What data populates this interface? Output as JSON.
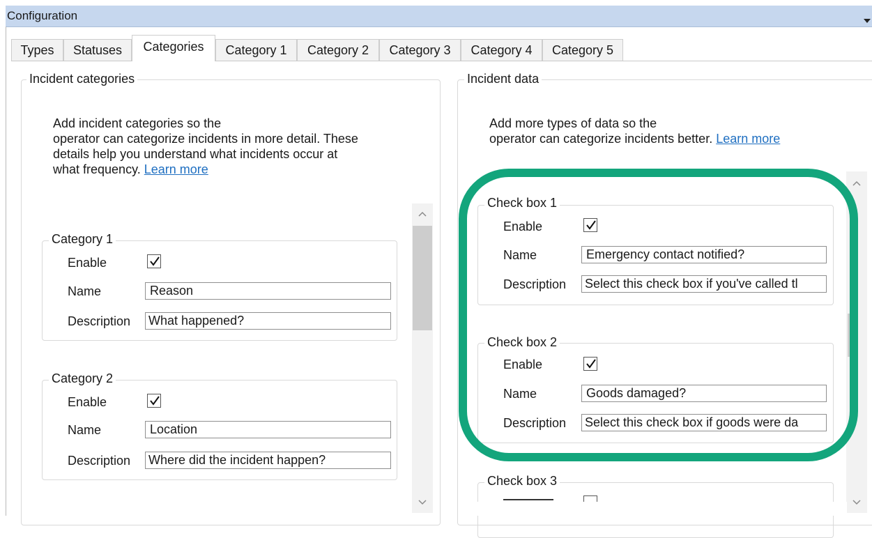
{
  "window": {
    "title": "Configuration"
  },
  "tabs": [
    {
      "label": "Types",
      "active": false
    },
    {
      "label": "Statuses",
      "active": false
    },
    {
      "label": "Categories",
      "active": true
    },
    {
      "label": "Category 1",
      "active": false
    },
    {
      "label": "Category 2",
      "active": false
    },
    {
      "label": "Category 3",
      "active": false
    },
    {
      "label": "Category 4",
      "active": false
    },
    {
      "label": "Category 5",
      "active": false
    }
  ],
  "left_panel": {
    "legend": "Incident categories",
    "intro_line1": "Add incident categories so the",
    "intro_line2": "operator can categorize incidents in more detail. These",
    "intro_line3": "details help you understand what incidents occur at",
    "intro_line4": "what frequency.",
    "learn_more": "Learn more",
    "categories": [
      {
        "legend": "Category 1",
        "enable_label": "Enable",
        "enabled": true,
        "name_label": "Name",
        "name_value": "Reason",
        "description_label": "Description",
        "description_value": "What happened?"
      },
      {
        "legend": "Category 2",
        "enable_label": "Enable",
        "enabled": true,
        "name_label": "Name",
        "name_value": "Location",
        "description_label": "Description",
        "description_value": "Where did the incident happen?"
      }
    ]
  },
  "right_panel": {
    "legend": "Incident data",
    "intro_line1": "Add more types of data so the",
    "intro_line2": "operator can categorize incidents better.",
    "learn_more": "Learn more",
    "checkboxes": [
      {
        "legend": "Check box 1",
        "enable_label": "Enable",
        "enabled": true,
        "name_label": "Name",
        "name_value": "Emergency contact notified?",
        "description_label": "Description",
        "description_value": "Select this check box if you've called tl"
      },
      {
        "legend": "Check box 2",
        "enable_label": "Enable",
        "enabled": true,
        "name_label": "Name",
        "name_value": "Goods damaged?",
        "description_label": "Description",
        "description_value": "Select this check box if goods were da"
      },
      {
        "legend": "Check box 3"
      }
    ]
  },
  "colors": {
    "highlight": "#13a57c",
    "titlebar": "#c6d7ee",
    "link": "#1f6fc1"
  },
  "icons": [
    "chevron-down-icon",
    "check-icon",
    "scroll-up-icon",
    "scroll-down-icon"
  ]
}
